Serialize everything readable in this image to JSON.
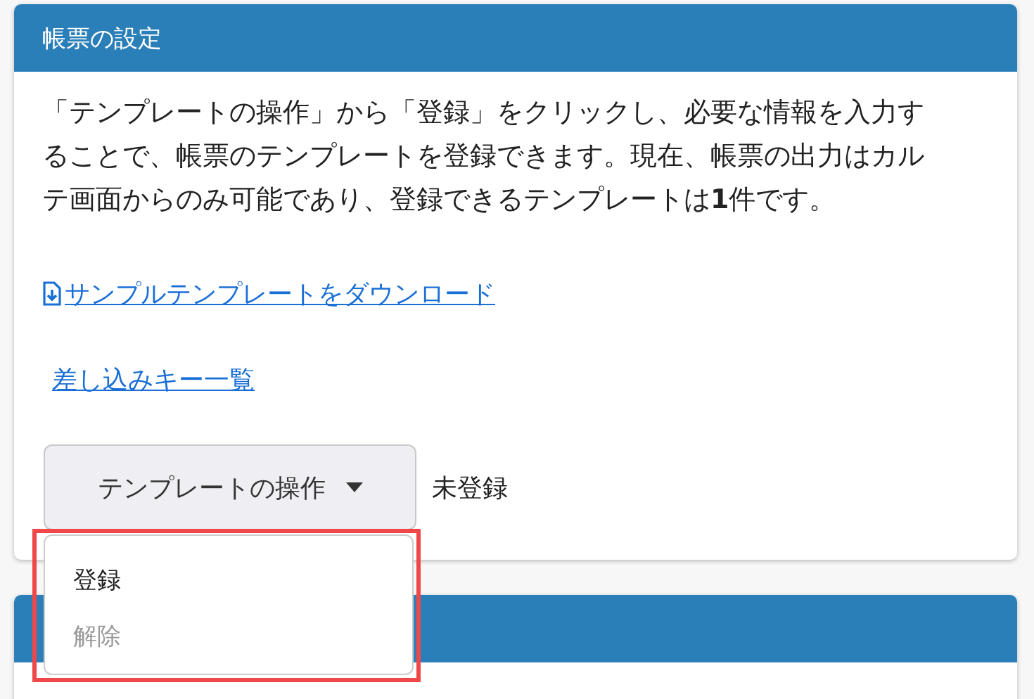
{
  "card": {
    "title": "帳票の設定",
    "description": "「テンプレートの操作」から「登録」をクリックし、必要な情報を入力することで、帳票のテンプレートを登録できます。現在、帳票の出力はカルテ画面からのみ可能であり、登録できるテンプレートは**1**件です。",
    "links": [
      {
        "label": "サンプルテンプレートをダウンロード",
        "kind": "download"
      },
      {
        "label": "差し込みキー一覧",
        "kind": "plain"
      }
    ],
    "dropdown": {
      "label": "テンプレートの操作",
      "expanded": true,
      "items": [
        {
          "label": "登録",
          "disabled": false
        },
        {
          "label": "解除",
          "disabled": true
        }
      ]
    },
    "status": "未登録"
  },
  "highlight": true
}
